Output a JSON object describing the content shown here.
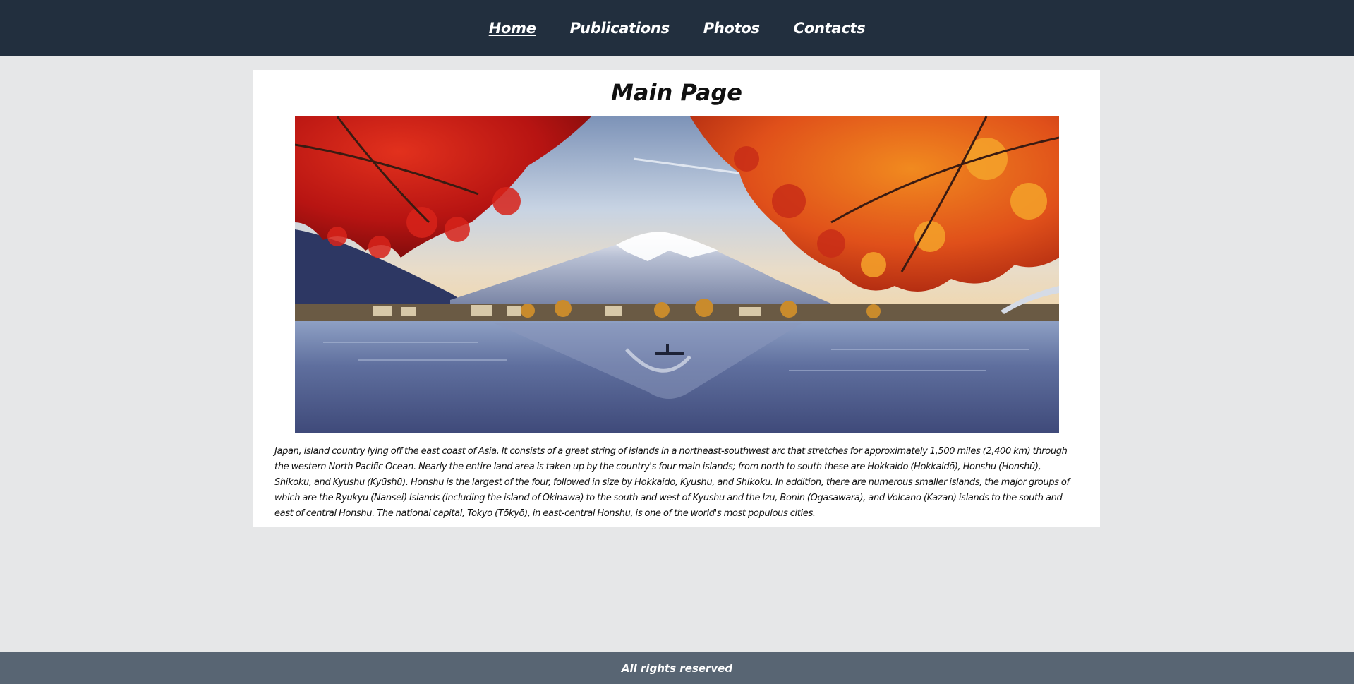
{
  "nav": {
    "items": [
      {
        "label": "Home",
        "active": true
      },
      {
        "label": "Publications",
        "active": false
      },
      {
        "label": "Photos",
        "active": false
      },
      {
        "label": "Contacts",
        "active": false
      }
    ]
  },
  "main": {
    "title": "Main Page",
    "paragraph": "Japan, island country lying off the east coast of Asia. It consists of a great string of islands in a northeast-southwest arc that stretches for approximately 1,500 miles (2,400 km) through the western North Pacific Ocean. Nearly the entire land area is taken up by the country's four main islands; from north to south these are Hokkaido (Hokkaidō), Honshu (Honshū), Shikoku, and Kyushu (Kyūshū). Honshu is the largest of the four, followed in size by Hokkaido, Kyushu, and Shikoku. In addition, there are numerous smaller islands, the major groups of which are the Ryukyu (Nansei) Islands (including the island of Okinawa) to the south and west of Kyushu and the Izu, Bonin (Ogasawara), and Volcano (Kazan) islands to the south and east of central Honshu. The national capital, Tokyo (Tōkyō), in east-central Honshu, is one of the world's most populous cities."
  },
  "footer": {
    "text": "All rights reserved"
  },
  "colors": {
    "nav_bg": "#222f3e",
    "footer_bg": "#586573",
    "page_bg": "#e6e7e8",
    "card_bg": "#ffffff"
  }
}
